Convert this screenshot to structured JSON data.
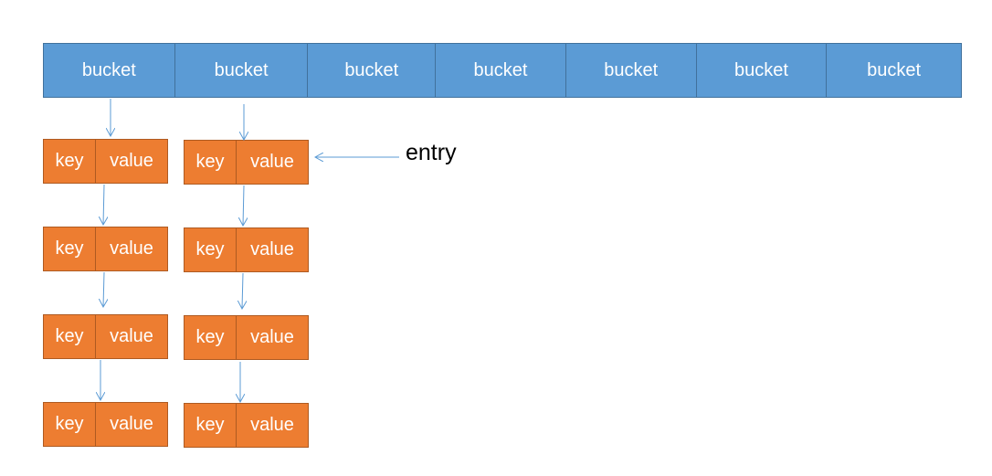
{
  "buckets": [
    "bucket",
    "bucket",
    "bucket",
    "bucket",
    "bucket",
    "bucket",
    "bucket"
  ],
  "chains": [
    [
      {
        "key": "key",
        "value": "value"
      },
      {
        "key": "key",
        "value": "value"
      },
      {
        "key": "key",
        "value": "value"
      },
      {
        "key": "key",
        "value": "value"
      }
    ],
    [
      {
        "key": "key",
        "value": "value"
      },
      {
        "key": "key",
        "value": "value"
      },
      {
        "key": "key",
        "value": "value"
      },
      {
        "key": "key",
        "value": "value"
      }
    ]
  ],
  "entry_label": "entry",
  "colors": {
    "bucket_fill": "#5b9bd5",
    "entry_fill": "#ed7d31",
    "arrow": "#5b9bd5"
  }
}
